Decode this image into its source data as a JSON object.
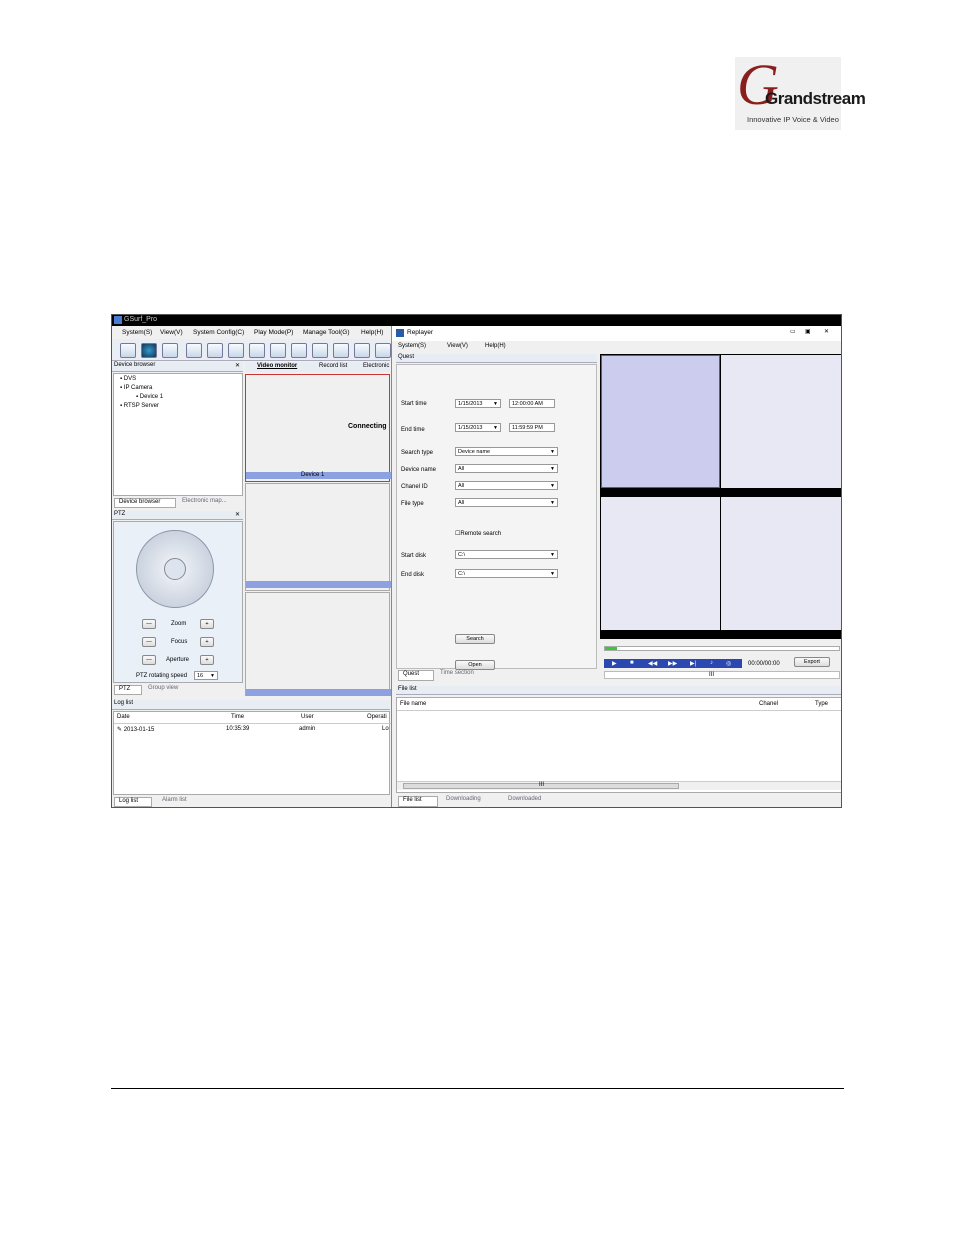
{
  "logo": {
    "brand": "Grandstream",
    "tagline": "Innovative IP Voice & Video"
  },
  "main_app": {
    "title": "GSurf_Pro",
    "menu": [
      "System(S)",
      "View(V)",
      "System Config(C)",
      "Play Mode(P)",
      "Manage Tool(G)",
      "Help(H)"
    ],
    "device_browser": {
      "header": "Device browser",
      "tree": [
        "DVS",
        "IP Camera",
        "Device 1",
        "RTSP Server"
      ],
      "tabs": [
        "Device browser",
        "Electronic map..."
      ]
    },
    "ptz": {
      "header": "PTZ",
      "zoom": "Zoom",
      "focus": "Focus",
      "aperture": "Aperture",
      "speed_label": "PTZ rotating speed",
      "speed_value": "16",
      "tabs": [
        "PTZ",
        "Group view"
      ]
    },
    "video_tabs": [
      "Video monitor",
      "Record list",
      "Electronic"
    ],
    "video_status": "Connecting",
    "video_device": "Device 1",
    "log": {
      "header": "Log list",
      "columns": [
        "Date",
        "Time",
        "User",
        "Operati"
      ],
      "rows": [
        [
          "2013-01-15",
          "10:35:39",
          "admin",
          "Lo"
        ]
      ],
      "tabs": [
        "Log list",
        "Alarm list"
      ]
    }
  },
  "replayer": {
    "title": "Replayer",
    "menu": [
      "System(S)",
      "View(V)",
      "Help(H)"
    ],
    "quest": {
      "header": "Quest",
      "start_time_label": "Start time",
      "start_date": "1/15/2013",
      "start_time": "12:00:00 AM",
      "end_time_label": "End time",
      "end_date": "1/15/2013",
      "end_time": "11:59:59 PM",
      "search_type_label": "Search type",
      "search_type": "Device name",
      "device_name_label": "Device name",
      "device_name": "All",
      "chanel_label": "Chanel ID",
      "chanel": "All",
      "file_type_label": "File type",
      "file_type": "All",
      "remote_search": "Remote search",
      "start_disk_label": "Start disk",
      "start_disk": "C:\\",
      "end_disk_label": "End disk",
      "end_disk": "C:\\",
      "search_btn": "Search",
      "open_btn": "Open",
      "tabs": [
        "Quest",
        "Time section"
      ]
    },
    "player": {
      "time": "00:00/00:00",
      "export_btn": "Export",
      "scroll_mark": "III"
    },
    "file_list": {
      "header": "File list",
      "columns": [
        "File name",
        "Chanel",
        "Type"
      ],
      "scroll_mark": "III",
      "tabs": [
        "File list",
        "Downloading",
        "Downloaded"
      ]
    }
  }
}
